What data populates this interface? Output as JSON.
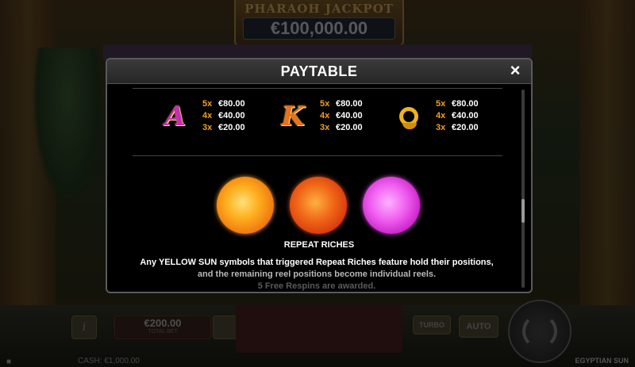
{
  "jackpot": {
    "title": "PHARAOH JACKPOT",
    "amount": "€100,000.00"
  },
  "paytable": {
    "title": "PAYTABLE",
    "close_icon": "×",
    "symbols": [
      {
        "symbol": "A",
        "icon": "letter-a-icon",
        "pays": [
          {
            "mult": "5x",
            "amount": "€80.00"
          },
          {
            "mult": "4x",
            "amount": "€40.00"
          },
          {
            "mult": "3x",
            "amount": "€20.00"
          }
        ]
      },
      {
        "symbol": "K",
        "icon": "letter-k-icon",
        "pays": [
          {
            "mult": "5x",
            "amount": "€80.00"
          },
          {
            "mult": "4x",
            "amount": "€40.00"
          },
          {
            "mult": "3x",
            "amount": "€20.00"
          }
        ]
      },
      {
        "symbol": "Q",
        "icon": "letter-q-icon",
        "pays": [
          {
            "mult": "5x",
            "amount": "€80.00"
          },
          {
            "mult": "4x",
            "amount": "€40.00"
          },
          {
            "mult": "3x",
            "amount": "€20.00"
          }
        ]
      }
    ],
    "feature": {
      "title": "REPEAT RICHES",
      "line1": "Any YELLOW SUN symbols that triggered Repeat Riches feature hold their positions,",
      "line2": "and the remaining reel positions become individual reels.",
      "line3": "5 Free Respins are awarded."
    },
    "colors": {
      "multiplier": "#f0a020",
      "amount": "#ffffff",
      "sun_yellow": "#ffb020",
      "sun_red": "#f06818",
      "sun_purple": "#f060f0"
    }
  },
  "bottom_bar": {
    "info_label": "i",
    "bet_value": "€200.00",
    "bet_label": "TOTAL BET",
    "turbo_label": "TURBO",
    "auto_label": "AUTO",
    "cash_label": "CASH:",
    "cash_value": "€1,000.00",
    "game_name": "EGYPTIAN SUN"
  }
}
